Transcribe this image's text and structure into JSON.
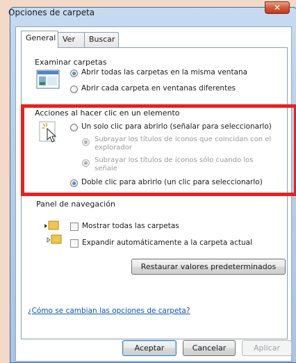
{
  "window": {
    "title": "Opciones de carpeta",
    "close_label": "✕"
  },
  "tabs": [
    "General",
    "Ver",
    "Buscar"
  ],
  "browse_folders": {
    "heading": "Examinar carpetas",
    "option_same_window": "Abrir todas las carpetas en la misma ventana",
    "option_new_window": "Abrir cada carpeta en ventanas diferentes"
  },
  "click_items": {
    "heading": "Acciones al hacer clic en un elemento",
    "single_click": "Un solo clic para abrirlo (señalar para seleccionarlo)",
    "underline_consistent_1": "Subrayar los títulos de iconos que coincidan con el",
    "underline_consistent_2": "explorador",
    "underline_hover_1": "Subrayar los títulos de iconos sólo cuando los",
    "underline_hover_2": "señale",
    "double_click": "Doble clic para abrirlo (un clic para seleccionarlo)"
  },
  "navigation_pane": {
    "heading": "Panel de navegación",
    "show_all_folders": "Mostrar todas las carpetas",
    "auto_expand": "Expandir automáticamente a la carpeta actual"
  },
  "restore_defaults": "Restaurar valores predeterminados",
  "help_link": "¿Cómo se cambian las opciones de carpeta?",
  "footer": {
    "ok": "Aceptar",
    "cancel": "Cancelar",
    "apply": "Aplicar"
  },
  "colors": {
    "highlight": "#e8211d",
    "link": "#0b56b8"
  }
}
